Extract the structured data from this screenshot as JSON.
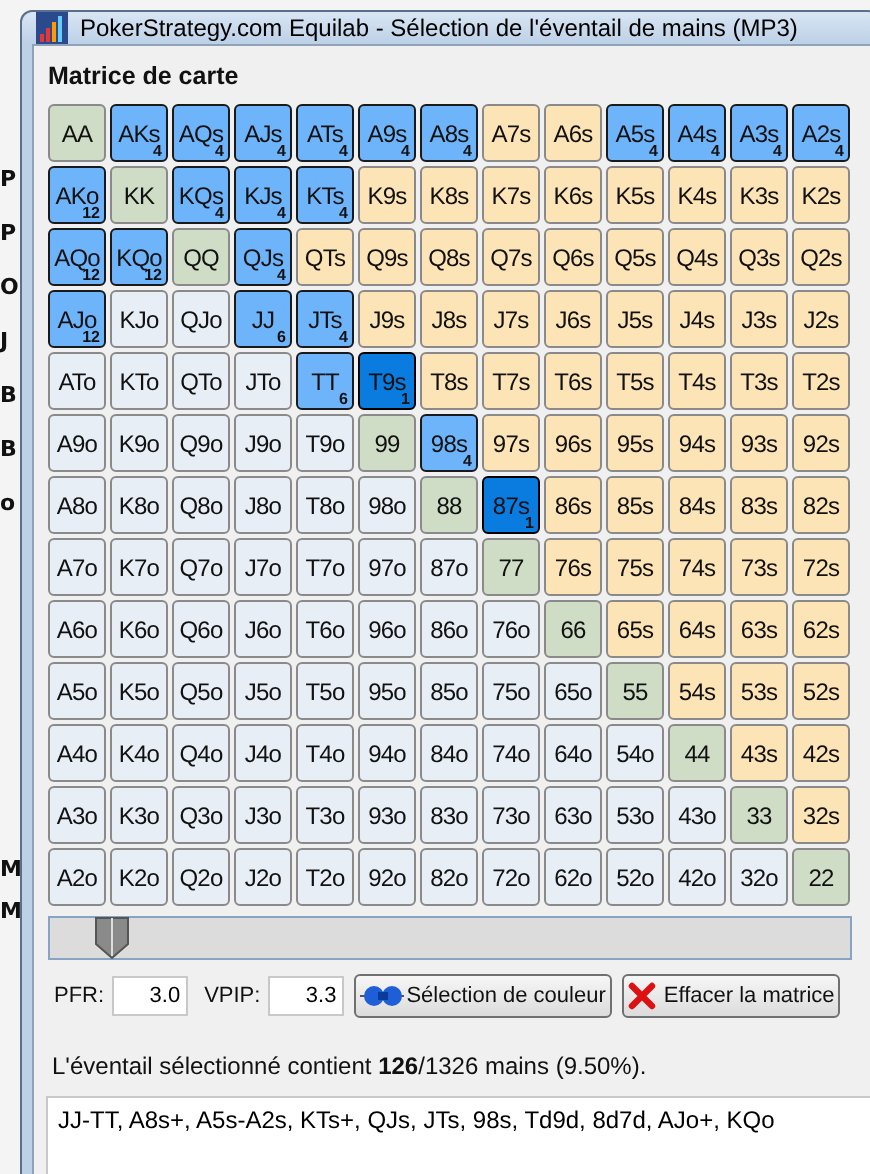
{
  "background_window": {
    "labels_top": [
      "P",
      "P",
      "O",
      "J",
      "B",
      "B",
      "o"
    ],
    "labels_bottom": [
      "M",
      "M"
    ]
  },
  "window": {
    "title": "PokerStrategy.com Equilab - Sélection de l'éventail de mains (MP3)"
  },
  "matrix": {
    "title": "Matrice de carte",
    "rows": [
      [
        {
          "hand": "AA",
          "kind": "pair",
          "selected": false,
          "partial": false
        },
        {
          "hand": "AKs",
          "kind": "suited",
          "selected": true,
          "partial": false,
          "combos": "4"
        },
        {
          "hand": "AQs",
          "kind": "suited",
          "selected": true,
          "partial": false,
          "combos": "4"
        },
        {
          "hand": "AJs",
          "kind": "suited",
          "selected": true,
          "partial": false,
          "combos": "4"
        },
        {
          "hand": "ATs",
          "kind": "suited",
          "selected": true,
          "partial": false,
          "combos": "4"
        },
        {
          "hand": "A9s",
          "kind": "suited",
          "selected": true,
          "partial": false,
          "combos": "4"
        },
        {
          "hand": "A8s",
          "kind": "suited",
          "selected": true,
          "partial": false,
          "combos": "4"
        },
        {
          "hand": "A7s",
          "kind": "suited",
          "selected": false,
          "partial": false
        },
        {
          "hand": "A6s",
          "kind": "suited",
          "selected": false,
          "partial": false
        },
        {
          "hand": "A5s",
          "kind": "suited",
          "selected": true,
          "partial": false,
          "combos": "4"
        },
        {
          "hand": "A4s",
          "kind": "suited",
          "selected": true,
          "partial": false,
          "combos": "4"
        },
        {
          "hand": "A3s",
          "kind": "suited",
          "selected": true,
          "partial": false,
          "combos": "4"
        },
        {
          "hand": "A2s",
          "kind": "suited",
          "selected": true,
          "partial": false,
          "combos": "4"
        }
      ],
      [
        {
          "hand": "AKo",
          "kind": "offsuit",
          "selected": true,
          "partial": false,
          "combos": "12"
        },
        {
          "hand": "KK",
          "kind": "pair",
          "selected": false,
          "partial": false
        },
        {
          "hand": "KQs",
          "kind": "suited",
          "selected": true,
          "partial": false,
          "combos": "4"
        },
        {
          "hand": "KJs",
          "kind": "suited",
          "selected": true,
          "partial": false,
          "combos": "4"
        },
        {
          "hand": "KTs",
          "kind": "suited",
          "selected": true,
          "partial": false,
          "combos": "4"
        },
        {
          "hand": "K9s",
          "kind": "suited",
          "selected": false,
          "partial": false
        },
        {
          "hand": "K8s",
          "kind": "suited",
          "selected": false,
          "partial": false
        },
        {
          "hand": "K7s",
          "kind": "suited",
          "selected": false,
          "partial": false
        },
        {
          "hand": "K6s",
          "kind": "suited",
          "selected": false,
          "partial": false
        },
        {
          "hand": "K5s",
          "kind": "suited",
          "selected": false,
          "partial": false
        },
        {
          "hand": "K4s",
          "kind": "suited",
          "selected": false,
          "partial": false
        },
        {
          "hand": "K3s",
          "kind": "suited",
          "selected": false,
          "partial": false
        },
        {
          "hand": "K2s",
          "kind": "suited",
          "selected": false,
          "partial": false
        }
      ],
      [
        {
          "hand": "AQo",
          "kind": "offsuit",
          "selected": true,
          "partial": false,
          "combos": "12"
        },
        {
          "hand": "KQo",
          "kind": "offsuit",
          "selected": true,
          "partial": false,
          "combos": "12"
        },
        {
          "hand": "QQ",
          "kind": "pair",
          "selected": false,
          "partial": false
        },
        {
          "hand": "QJs",
          "kind": "suited",
          "selected": true,
          "partial": false,
          "combos": "4"
        },
        {
          "hand": "QTs",
          "kind": "suited",
          "selected": false,
          "partial": false
        },
        {
          "hand": "Q9s",
          "kind": "suited",
          "selected": false,
          "partial": false
        },
        {
          "hand": "Q8s",
          "kind": "suited",
          "selected": false,
          "partial": false
        },
        {
          "hand": "Q7s",
          "kind": "suited",
          "selected": false,
          "partial": false
        },
        {
          "hand": "Q6s",
          "kind": "suited",
          "selected": false,
          "partial": false
        },
        {
          "hand": "Q5s",
          "kind": "suited",
          "selected": false,
          "partial": false
        },
        {
          "hand": "Q4s",
          "kind": "suited",
          "selected": false,
          "partial": false
        },
        {
          "hand": "Q3s",
          "kind": "suited",
          "selected": false,
          "partial": false
        },
        {
          "hand": "Q2s",
          "kind": "suited",
          "selected": false,
          "partial": false
        }
      ],
      [
        {
          "hand": "AJo",
          "kind": "offsuit",
          "selected": true,
          "partial": false,
          "combos": "12"
        },
        {
          "hand": "KJo",
          "kind": "offsuit",
          "selected": false,
          "partial": false
        },
        {
          "hand": "QJo",
          "kind": "offsuit",
          "selected": false,
          "partial": false
        },
        {
          "hand": "JJ",
          "kind": "pair",
          "selected": true,
          "partial": false,
          "combos": "6"
        },
        {
          "hand": "JTs",
          "kind": "suited",
          "selected": true,
          "partial": false,
          "combos": "4"
        },
        {
          "hand": "J9s",
          "kind": "suited",
          "selected": false,
          "partial": false
        },
        {
          "hand": "J8s",
          "kind": "suited",
          "selected": false,
          "partial": false
        },
        {
          "hand": "J7s",
          "kind": "suited",
          "selected": false,
          "partial": false
        },
        {
          "hand": "J6s",
          "kind": "suited",
          "selected": false,
          "partial": false
        },
        {
          "hand": "J5s",
          "kind": "suited",
          "selected": false,
          "partial": false
        },
        {
          "hand": "J4s",
          "kind": "suited",
          "selected": false,
          "partial": false
        },
        {
          "hand": "J3s",
          "kind": "suited",
          "selected": false,
          "partial": false
        },
        {
          "hand": "J2s",
          "kind": "suited",
          "selected": false,
          "partial": false
        }
      ],
      [
        {
          "hand": "ATo",
          "kind": "offsuit",
          "selected": false,
          "partial": false
        },
        {
          "hand": "KTo",
          "kind": "offsuit",
          "selected": false,
          "partial": false
        },
        {
          "hand": "QTo",
          "kind": "offsuit",
          "selected": false,
          "partial": false
        },
        {
          "hand": "JTo",
          "kind": "offsuit",
          "selected": false,
          "partial": false
        },
        {
          "hand": "TT",
          "kind": "pair",
          "selected": true,
          "partial": false,
          "combos": "6"
        },
        {
          "hand": "T9s",
          "kind": "suited",
          "selected": true,
          "partial": true,
          "combos": "1"
        },
        {
          "hand": "T8s",
          "kind": "suited",
          "selected": false,
          "partial": false
        },
        {
          "hand": "T7s",
          "kind": "suited",
          "selected": false,
          "partial": false
        },
        {
          "hand": "T6s",
          "kind": "suited",
          "selected": false,
          "partial": false
        },
        {
          "hand": "T5s",
          "kind": "suited",
          "selected": false,
          "partial": false
        },
        {
          "hand": "T4s",
          "kind": "suited",
          "selected": false,
          "partial": false
        },
        {
          "hand": "T3s",
          "kind": "suited",
          "selected": false,
          "partial": false
        },
        {
          "hand": "T2s",
          "kind": "suited",
          "selected": false,
          "partial": false
        }
      ],
      [
        {
          "hand": "A9o",
          "kind": "offsuit",
          "selected": false,
          "partial": false
        },
        {
          "hand": "K9o",
          "kind": "offsuit",
          "selected": false,
          "partial": false
        },
        {
          "hand": "Q9o",
          "kind": "offsuit",
          "selected": false,
          "partial": false
        },
        {
          "hand": "J9o",
          "kind": "offsuit",
          "selected": false,
          "partial": false
        },
        {
          "hand": "T9o",
          "kind": "offsuit",
          "selected": false,
          "partial": false
        },
        {
          "hand": "99",
          "kind": "pair",
          "selected": false,
          "partial": false
        },
        {
          "hand": "98s",
          "kind": "suited",
          "selected": true,
          "partial": false,
          "combos": "4"
        },
        {
          "hand": "97s",
          "kind": "suited",
          "selected": false,
          "partial": false
        },
        {
          "hand": "96s",
          "kind": "suited",
          "selected": false,
          "partial": false
        },
        {
          "hand": "95s",
          "kind": "suited",
          "selected": false,
          "partial": false
        },
        {
          "hand": "94s",
          "kind": "suited",
          "selected": false,
          "partial": false
        },
        {
          "hand": "93s",
          "kind": "suited",
          "selected": false,
          "partial": false
        },
        {
          "hand": "92s",
          "kind": "suited",
          "selected": false,
          "partial": false
        }
      ],
      [
        {
          "hand": "A8o",
          "kind": "offsuit",
          "selected": false,
          "partial": false
        },
        {
          "hand": "K8o",
          "kind": "offsuit",
          "selected": false,
          "partial": false
        },
        {
          "hand": "Q8o",
          "kind": "offsuit",
          "selected": false,
          "partial": false
        },
        {
          "hand": "J8o",
          "kind": "offsuit",
          "selected": false,
          "partial": false
        },
        {
          "hand": "T8o",
          "kind": "offsuit",
          "selected": false,
          "partial": false
        },
        {
          "hand": "98o",
          "kind": "offsuit",
          "selected": false,
          "partial": false
        },
        {
          "hand": "88",
          "kind": "pair",
          "selected": false,
          "partial": false
        },
        {
          "hand": "87s",
          "kind": "suited",
          "selected": true,
          "partial": true,
          "combos": "1"
        },
        {
          "hand": "86s",
          "kind": "suited",
          "selected": false,
          "partial": false
        },
        {
          "hand": "85s",
          "kind": "suited",
          "selected": false,
          "partial": false
        },
        {
          "hand": "84s",
          "kind": "suited",
          "selected": false,
          "partial": false
        },
        {
          "hand": "83s",
          "kind": "suited",
          "selected": false,
          "partial": false
        },
        {
          "hand": "82s",
          "kind": "suited",
          "selected": false,
          "partial": false
        }
      ],
      [
        {
          "hand": "A7o",
          "kind": "offsuit",
          "selected": false,
          "partial": false
        },
        {
          "hand": "K7o",
          "kind": "offsuit",
          "selected": false,
          "partial": false
        },
        {
          "hand": "Q7o",
          "kind": "offsuit",
          "selected": false,
          "partial": false
        },
        {
          "hand": "J7o",
          "kind": "offsuit",
          "selected": false,
          "partial": false
        },
        {
          "hand": "T7o",
          "kind": "offsuit",
          "selected": false,
          "partial": false
        },
        {
          "hand": "97o",
          "kind": "offsuit",
          "selected": false,
          "partial": false
        },
        {
          "hand": "87o",
          "kind": "offsuit",
          "selected": false,
          "partial": false
        },
        {
          "hand": "77",
          "kind": "pair",
          "selected": false,
          "partial": false
        },
        {
          "hand": "76s",
          "kind": "suited",
          "selected": false,
          "partial": false
        },
        {
          "hand": "75s",
          "kind": "suited",
          "selected": false,
          "partial": false
        },
        {
          "hand": "74s",
          "kind": "suited",
          "selected": false,
          "partial": false
        },
        {
          "hand": "73s",
          "kind": "suited",
          "selected": false,
          "partial": false
        },
        {
          "hand": "72s",
          "kind": "suited",
          "selected": false,
          "partial": false
        }
      ],
      [
        {
          "hand": "A6o",
          "kind": "offsuit",
          "selected": false,
          "partial": false
        },
        {
          "hand": "K6o",
          "kind": "offsuit",
          "selected": false,
          "partial": false
        },
        {
          "hand": "Q6o",
          "kind": "offsuit",
          "selected": false,
          "partial": false
        },
        {
          "hand": "J6o",
          "kind": "offsuit",
          "selected": false,
          "partial": false
        },
        {
          "hand": "T6o",
          "kind": "offsuit",
          "selected": false,
          "partial": false
        },
        {
          "hand": "96o",
          "kind": "offsuit",
          "selected": false,
          "partial": false
        },
        {
          "hand": "86o",
          "kind": "offsuit",
          "selected": false,
          "partial": false
        },
        {
          "hand": "76o",
          "kind": "offsuit",
          "selected": false,
          "partial": false
        },
        {
          "hand": "66",
          "kind": "pair",
          "selected": false,
          "partial": false
        },
        {
          "hand": "65s",
          "kind": "suited",
          "selected": false,
          "partial": false
        },
        {
          "hand": "64s",
          "kind": "suited",
          "selected": false,
          "partial": false
        },
        {
          "hand": "63s",
          "kind": "suited",
          "selected": false,
          "partial": false
        },
        {
          "hand": "62s",
          "kind": "suited",
          "selected": false,
          "partial": false
        }
      ],
      [
        {
          "hand": "A5o",
          "kind": "offsuit",
          "selected": false,
          "partial": false
        },
        {
          "hand": "K5o",
          "kind": "offsuit",
          "selected": false,
          "partial": false
        },
        {
          "hand": "Q5o",
          "kind": "offsuit",
          "selected": false,
          "partial": false
        },
        {
          "hand": "J5o",
          "kind": "offsuit",
          "selected": false,
          "partial": false
        },
        {
          "hand": "T5o",
          "kind": "offsuit",
          "selected": false,
          "partial": false
        },
        {
          "hand": "95o",
          "kind": "offsuit",
          "selected": false,
          "partial": false
        },
        {
          "hand": "85o",
          "kind": "offsuit",
          "selected": false,
          "partial": false
        },
        {
          "hand": "75o",
          "kind": "offsuit",
          "selected": false,
          "partial": false
        },
        {
          "hand": "65o",
          "kind": "offsuit",
          "selected": false,
          "partial": false
        },
        {
          "hand": "55",
          "kind": "pair",
          "selected": false,
          "partial": false
        },
        {
          "hand": "54s",
          "kind": "suited",
          "selected": false,
          "partial": false
        },
        {
          "hand": "53s",
          "kind": "suited",
          "selected": false,
          "partial": false
        },
        {
          "hand": "52s",
          "kind": "suited",
          "selected": false,
          "partial": false
        }
      ],
      [
        {
          "hand": "A4o",
          "kind": "offsuit",
          "selected": false,
          "partial": false
        },
        {
          "hand": "K4o",
          "kind": "offsuit",
          "selected": false,
          "partial": false
        },
        {
          "hand": "Q4o",
          "kind": "offsuit",
          "selected": false,
          "partial": false
        },
        {
          "hand": "J4o",
          "kind": "offsuit",
          "selected": false,
          "partial": false
        },
        {
          "hand": "T4o",
          "kind": "offsuit",
          "selected": false,
          "partial": false
        },
        {
          "hand": "94o",
          "kind": "offsuit",
          "selected": false,
          "partial": false
        },
        {
          "hand": "84o",
          "kind": "offsuit",
          "selected": false,
          "partial": false
        },
        {
          "hand": "74o",
          "kind": "offsuit",
          "selected": false,
          "partial": false
        },
        {
          "hand": "64o",
          "kind": "offsuit",
          "selected": false,
          "partial": false
        },
        {
          "hand": "54o",
          "kind": "offsuit",
          "selected": false,
          "partial": false
        },
        {
          "hand": "44",
          "kind": "pair",
          "selected": false,
          "partial": false
        },
        {
          "hand": "43s",
          "kind": "suited",
          "selected": false,
          "partial": false
        },
        {
          "hand": "42s",
          "kind": "suited",
          "selected": false,
          "partial": false
        }
      ],
      [
        {
          "hand": "A3o",
          "kind": "offsuit",
          "selected": false,
          "partial": false
        },
        {
          "hand": "K3o",
          "kind": "offsuit",
          "selected": false,
          "partial": false
        },
        {
          "hand": "Q3o",
          "kind": "offsuit",
          "selected": false,
          "partial": false
        },
        {
          "hand": "J3o",
          "kind": "offsuit",
          "selected": false,
          "partial": false
        },
        {
          "hand": "T3o",
          "kind": "offsuit",
          "selected": false,
          "partial": false
        },
        {
          "hand": "93o",
          "kind": "offsuit",
          "selected": false,
          "partial": false
        },
        {
          "hand": "83o",
          "kind": "offsuit",
          "selected": false,
          "partial": false
        },
        {
          "hand": "73o",
          "kind": "offsuit",
          "selected": false,
          "partial": false
        },
        {
          "hand": "63o",
          "kind": "offsuit",
          "selected": false,
          "partial": false
        },
        {
          "hand": "53o",
          "kind": "offsuit",
          "selected": false,
          "partial": false
        },
        {
          "hand": "43o",
          "kind": "offsuit",
          "selected": false,
          "partial": false
        },
        {
          "hand": "33",
          "kind": "pair",
          "selected": false,
          "partial": false
        },
        {
          "hand": "32s",
          "kind": "suited",
          "selected": false,
          "partial": false
        }
      ],
      [
        {
          "hand": "A2o",
          "kind": "offsuit",
          "selected": false,
          "partial": false
        },
        {
          "hand": "K2o",
          "kind": "offsuit",
          "selected": false,
          "partial": false
        },
        {
          "hand": "Q2o",
          "kind": "offsuit",
          "selected": false,
          "partial": false
        },
        {
          "hand": "J2o",
          "kind": "offsuit",
          "selected": false,
          "partial": false
        },
        {
          "hand": "T2o",
          "kind": "offsuit",
          "selected": false,
          "partial": false
        },
        {
          "hand": "92o",
          "kind": "offsuit",
          "selected": false,
          "partial": false
        },
        {
          "hand": "82o",
          "kind": "offsuit",
          "selected": false,
          "partial": false
        },
        {
          "hand": "72o",
          "kind": "offsuit",
          "selected": false,
          "partial": false
        },
        {
          "hand": "62o",
          "kind": "offsuit",
          "selected": false,
          "partial": false
        },
        {
          "hand": "52o",
          "kind": "offsuit",
          "selected": false,
          "partial": false
        },
        {
          "hand": "42o",
          "kind": "offsuit",
          "selected": false,
          "partial": false
        },
        {
          "hand": "32o",
          "kind": "offsuit",
          "selected": false,
          "partial": false
        },
        {
          "hand": "22",
          "kind": "pair",
          "selected": false,
          "partial": false
        }
      ]
    ]
  },
  "slider": {
    "level": 0.05
  },
  "pfr": {
    "label": "PFR:",
    "value": "3.0"
  },
  "vpip": {
    "label": "VPIP:",
    "value": "3.3"
  },
  "buttons": [
    {
      "label": "Sélection de couleur",
      "kind": "color"
    },
    {
      "label": "Effacer la matrice",
      "kind": "clear"
    }
  ],
  "summary": "L'éventail sélectionné contient **126**/1326 mains (9.50%).",
  "range_text": "JJ-TT, A8s+, A5s-A2s, KTs+, QJs, JTs, 98s, Td9d, 8d7d, AJo+, KQo"
}
